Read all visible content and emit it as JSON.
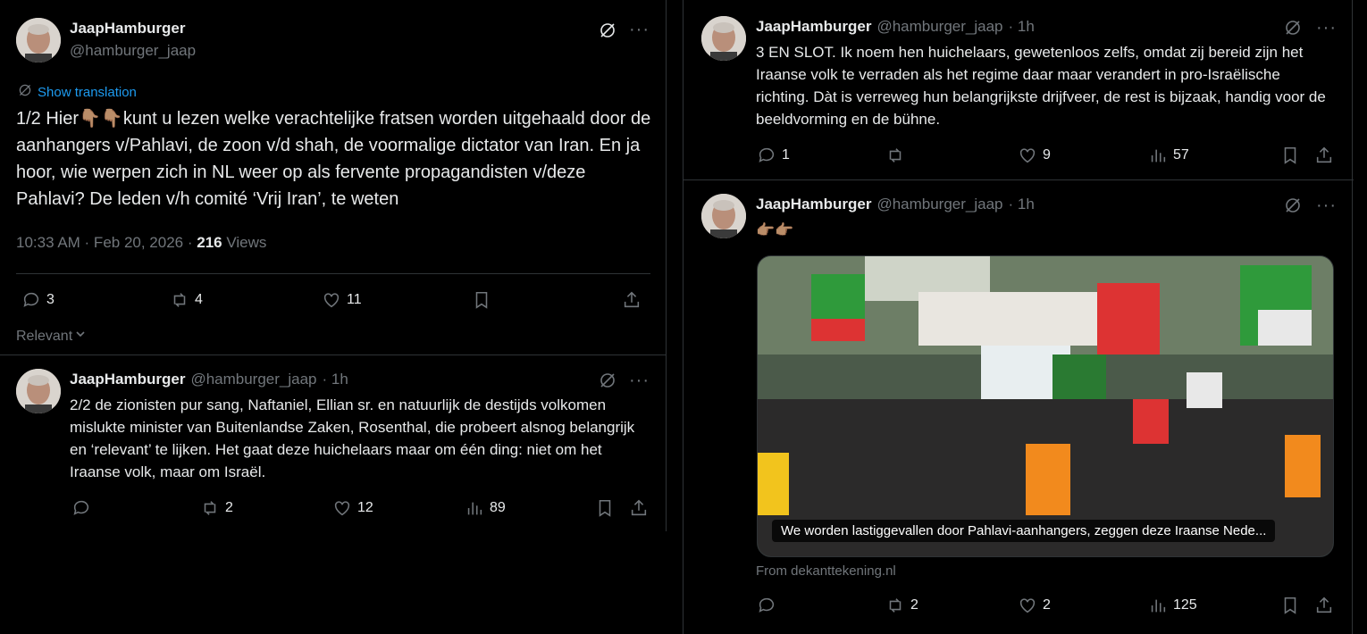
{
  "main_tweet": {
    "name": "JaapHamburger",
    "handle": "@hamburger_jaap",
    "translate_label": "Show translation",
    "text": "1/2 Hier👇🏽👇🏽kunt u lezen welke verachtelijke fratsen worden uitgehaald door de aanhangers v/Pahlavi, de zoon v/d shah, de voormalige dictator van Iran. En ja hoor, wie werpen zich  in NL weer op als fervente propagandisten v/deze Pahlavi? De leden v/h comité ‘Vrij Iran’, te weten",
    "time": "10:33 AM · Feb 20, 2026 · ",
    "views_count": "216",
    "views_label": " Views",
    "replies": "3",
    "reposts": "4",
    "likes": "11",
    "sort_label": "Relevant"
  },
  "reply_tweet": {
    "name": "JaapHamburger",
    "handle": "@hamburger_jaap",
    "time": "· 1h",
    "text": "2/2 de zionisten pur sang, Naftaniel, Ellian sr. en natuurlijk de destijds volkomen mislukte minister van Buitenlandse Zaken, Rosenthal, die probeert alsnog belangrijk en ‘relevant’ te lijken. Het gaat deze huichelaars maar om één ding: niet  om het Iraanse volk, maar om Israël.",
    "replies": "",
    "reposts": "2",
    "likes": "12",
    "views": "89"
  },
  "right_tweet_1": {
    "name": "JaapHamburger",
    "handle": "@hamburger_jaap",
    "time": "· 1h",
    "text": "3 EN SLOT. Ik noem hen huichelaars, gewetenloos zelfs, omdat zij bereid zijn het Iraanse volk te verraden als het regime daar maar verandert in pro-Israëlische richting. Dàt is verreweg hun belangrijkste drijfveer, de rest is bijzaak, handig voor de beeldvorming en de bühne.",
    "replies": "1",
    "reposts": "",
    "likes": "9",
    "views": "57"
  },
  "right_tweet_2": {
    "name": "JaapHamburger",
    "handle": "@hamburger_jaap",
    "time": "· 1h",
    "text": "👉🏽👉🏽",
    "card_caption": "We worden lastiggevallen door Pahlavi-aanhangers, zeggen deze Iraanse Nede...",
    "card_source": "From dekanttekening.nl",
    "replies": "",
    "reposts": "2",
    "likes": "2",
    "views": "125"
  },
  "colors": {
    "background": "#000000",
    "text": "#e7e9ea",
    "muted": "#71767b",
    "link": "#1d9bf0",
    "border": "#2f3336"
  },
  "icons": [
    "grok-icon",
    "more-icon",
    "reply-icon",
    "repost-icon",
    "like-icon",
    "views-icon",
    "bookmark-icon",
    "share-icon",
    "translate-icon",
    "chevron-down-icon"
  ]
}
